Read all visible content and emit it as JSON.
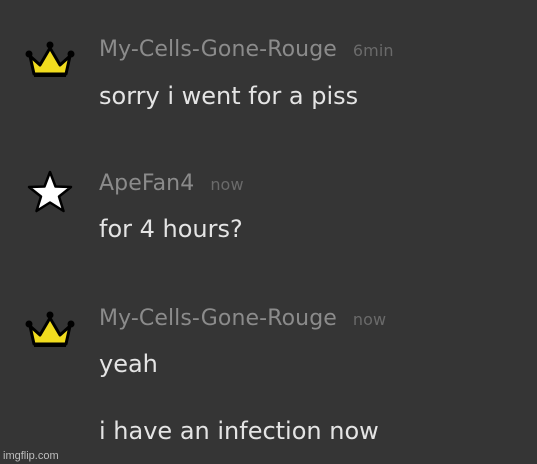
{
  "messages": [
    {
      "username": "My-Cells-Gone-Rouge",
      "time": "6min",
      "badge": "crown-icon",
      "lines": [
        "sorry i went for a piss"
      ]
    },
    {
      "username": "ApeFan4",
      "time": "now",
      "badge": "star-icon",
      "lines": [
        "for 4 hours?"
      ]
    },
    {
      "username": "My-Cells-Gone-Rouge",
      "time": "now",
      "badge": "crown-icon",
      "lines": [
        "yeah",
        "i have an infection now"
      ]
    }
  ],
  "colors": {
    "background": "#353535",
    "username": "#8b8b8b",
    "timestamp": "#6a6a6a",
    "message_text": "#e4e4e4",
    "crown": "#f1dc1e",
    "star": "#ffffff"
  },
  "watermark": "imgflip.com"
}
